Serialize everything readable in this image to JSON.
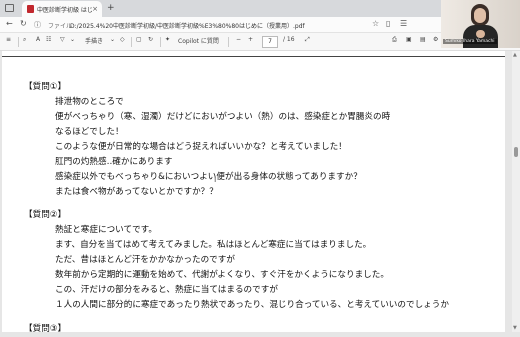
{
  "browser": {
    "tab_title": "中医診断学初級 はじめに（授業用）",
    "tab_close": "×",
    "new_tab": "+",
    "file_label": "ファイル",
    "url": "D:/2025.4%20中医診断学初級/中医診断学初級%E3%80%80はじめに（授業用）.pdf",
    "back": "←",
    "refresh": "↻"
  },
  "toolbar": {
    "handwriting_label": "手描き",
    "copilot_label": "Copilot に質問",
    "page_current": "7",
    "page_total": "/ 16",
    "zoom_minus": "−",
    "zoom_plus": "+",
    "menu": "≡"
  },
  "video": {
    "name_tag": "Sumiko Ihara Yamachi"
  },
  "document": {
    "sections": [
      {
        "heading": "【質問①】",
        "lines": [
          "排泄物のところで",
          "便がべっちゃり（寒、湿濁）だけどにおいがつよい（熱）のは、感染症とか胃腸炎の時",
          "なるほどでした！",
          "このような便が日常的な場合はどう捉えればいいかな？と考えていました！",
          "肛門の灼熱感‥確かにあります",
          "感染症以外でもべっちゃり&においつよい便が出る身体の状態ってありますか？",
          "または食べ物があってないとかですか？？"
        ]
      },
      {
        "heading": "【質問②】",
        "lines": [
          "熱証と寒症についてです。",
          "ます、自分を当てはめて考えてみました。私はほとんど寒症に当てはまりました。",
          "ただ、昔はほとんど汗をかかなかったのですが",
          "数年前から定期的に運動を始めて、代謝がよくなり、すぐ汗をかくようになりました。",
          "この、汗だけの部分をみると、熱症に当てはまるのですが",
          "１人の人間に部分的に寒症であったり熱状であったり、混じり合っている、と考えていいのでしょうか"
        ]
      },
      {
        "heading": "【質問③】",
        "lines": []
      }
    ]
  }
}
